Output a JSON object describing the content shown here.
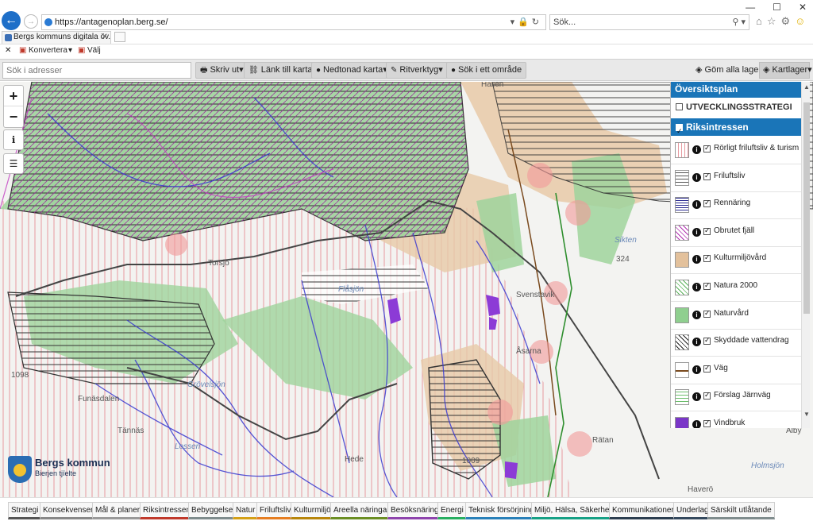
{
  "browser": {
    "url": "https://antagenoplan.berg.se/",
    "search_placeholder": "Sök...",
    "tab_title": "Bergs kommuns digitala öv...",
    "cmd_convert": "Konvertera",
    "cmd_select": "Välj"
  },
  "toolbar": {
    "address_placeholder": "Sök i adresser",
    "print": "Skriv ut",
    "link": "Länk till karta",
    "download": "Nedtonad karta",
    "draw": "Ritverktyg",
    "area_search": "Sök i ett område",
    "hide_layers": "Göm alla lager",
    "map_layers": "Kartlager"
  },
  "panel": {
    "header": "Översiktsplan",
    "strategy": "UTVECKLINGSSTRATEGI",
    "group": "Riksintressen",
    "layers": [
      {
        "label": "Rörligt friluftsliv & turism",
        "swatch": "pink-vertical"
      },
      {
        "label": "Friluftsliv",
        "swatch": "grey-horizontal"
      },
      {
        "label": "Rennäring",
        "swatch": "blue-horizontal"
      },
      {
        "label": "Obrutet fjäll",
        "swatch": "magenta-diagonal"
      },
      {
        "label": "Kulturmiljövård",
        "swatch": "tan-fill"
      },
      {
        "label": "Natura 2000",
        "swatch": "green-diagonal"
      },
      {
        "label": "Naturvård",
        "swatch": "green-fill"
      },
      {
        "label": "Skyddade vattendrag",
        "swatch": "black-diagonal"
      },
      {
        "label": "Väg",
        "swatch": "brown-line"
      },
      {
        "label": "Förslag Järnväg",
        "swatch": "green-horizontal"
      },
      {
        "label": "Vindbruk",
        "swatch": "purple-fill"
      }
    ]
  },
  "map_labels": {
    "torsjo": "Torsjö",
    "flasjon": "Flåsjön",
    "svenstavik": "Svenstavik",
    "asarna": "Åsarna",
    "hede": "Hede",
    "tannas": "Tännäs",
    "ratan": "Rätan",
    "havero": "Haverö",
    "alby": "Alby",
    "number_324": "324",
    "number_1098": "1098",
    "number_1009": "1009",
    "funasdalen": "Funäsdalen",
    "lossen": "Lossen",
    "grovelsjon": "Grövelsjön",
    "hoimsjon": "Holmsjön",
    "malen": "Hallen",
    "sakten": "Sikten"
  },
  "logo": {
    "name": "Bergs kommun",
    "tagline": "Bierjen tjïelte"
  },
  "bottom_tabs": [
    {
      "label": "Strategi",
      "color": "#555555"
    },
    {
      "label": "Konsekvenser",
      "color": "#888888"
    },
    {
      "label": "Mål & planer",
      "color": "#999999"
    },
    {
      "label": "Riksintressen",
      "color": "#c0392b"
    },
    {
      "label": "Bebyggelse",
      "color": "#7f8c8d"
    },
    {
      "label": "Natur",
      "color": "#d4a017"
    },
    {
      "label": "Friluftsliv",
      "color": "#e67e22"
    },
    {
      "label": "Kulturmiljö",
      "color": "#b8860b"
    },
    {
      "label": "Areella näringar",
      "color": "#6b8e23"
    },
    {
      "label": "Besöksnäring",
      "color": "#8e44ad"
    },
    {
      "label": "Energi",
      "color": "#27ae60"
    },
    {
      "label": "Teknisk försörjning",
      "color": "#2980b9"
    },
    {
      "label": "Miljö, Hälsa, Säkerhet",
      "color": "#16a085"
    },
    {
      "label": "Kommunikationer",
      "color": "#2c3e50"
    },
    {
      "label": "Underlag",
      "color": "#34495e"
    },
    {
      "label": "Särskilt utlåtande",
      "color": "#7f8c8d"
    }
  ]
}
